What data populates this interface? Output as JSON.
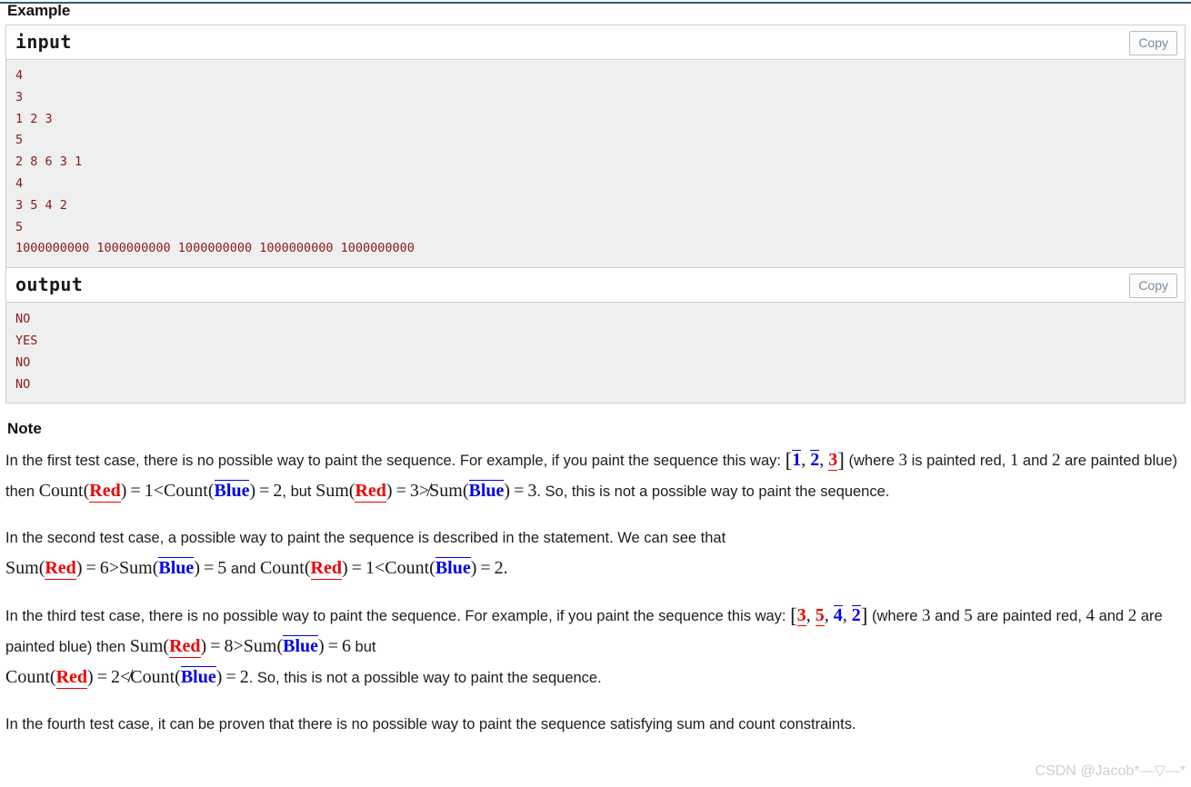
{
  "theme": {
    "top_rule_color": "#2f5b77",
    "code_text_color": "#8b1a1a",
    "code_bg_color": "#efefef",
    "red_accent": "#ee0000",
    "blue_accent": "#0000ee",
    "border_color": "#cfcfcf",
    "copy_button_text_color": "#7c8c9a",
    "watermark_color": "#c9cfd6"
  },
  "example": {
    "heading": "Example",
    "input_block": {
      "title": "input",
      "copy_label": "Copy",
      "lines": [
        "4",
        "3",
        "1 2 3",
        "5",
        "2 8 6 3 1",
        "4",
        "3 5 4 2",
        "5",
        "1000000000 1000000000 1000000000 1000000000 1000000000"
      ]
    },
    "output_block": {
      "title": "output",
      "copy_label": "Copy",
      "lines": [
        "NO",
        "YES",
        "NO",
        "NO"
      ]
    }
  },
  "note": {
    "heading": "Note",
    "p1": {
      "t1": "In the first test case, there is no possible way to paint the sequence. For example, if you paint the sequence this way: ",
      "seq": {
        "open": "[",
        "items": [
          "1",
          "2",
          "3"
        ],
        "colors": [
          "blue",
          "blue",
          "red"
        ],
        "close": "]",
        "sep": ", "
      },
      "t2": " (where ",
      "n3": "3",
      "t3": " is painted red, ",
      "n1": "1",
      "t4": " and ",
      "n2": "2",
      "t5": " are painted blue) then ",
      "count_red_lhs": {
        "fn": "Count",
        "arg": "Red",
        "eq": "=",
        "val": "1"
      },
      "rel1": "<",
      "count_blue_rhs": {
        "fn": "Count",
        "arg": "Blue",
        "eq": "=",
        "val": "2"
      },
      "t6": ", but ",
      "sum_red": {
        "fn": "Sum",
        "arg": "Red",
        "eq": "=",
        "val": "3"
      },
      "rel2": "≯",
      "sum_blue": {
        "fn": "Sum",
        "arg": "Blue",
        "eq": "=",
        "val": "3"
      },
      "t7": ". So, this is not a possible way to paint the sequence."
    },
    "p2": {
      "t1": "In the second test case, a possible way to paint the sequence is described in the statement. We can see that",
      "sum_red": {
        "fn": "Sum",
        "arg": "Red",
        "eq": "=",
        "val": "6"
      },
      "rel1": ">",
      "sum_blue": {
        "fn": "Sum",
        "arg": "Blue",
        "eq": "=",
        "val": "5"
      },
      "t2": " and ",
      "count_red": {
        "fn": "Count",
        "arg": "Red",
        "eq": "=",
        "val": "1"
      },
      "rel2": "<",
      "count_blue": {
        "fn": "Count",
        "arg": "Blue",
        "eq": "=",
        "val": "2"
      },
      "t3": "."
    },
    "p3": {
      "t1": "In the third test case, there is no possible way to paint the sequence. For example, if you paint the sequence this way: ",
      "seq": {
        "open": "[",
        "items": [
          "3",
          "5",
          "4",
          "2"
        ],
        "colors": [
          "red",
          "red",
          "blue",
          "blue"
        ],
        "close": "]",
        "sep": ", "
      },
      "t2": " (where ",
      "n3": "3",
      "t3": " and ",
      "n5": "5",
      "t4": " are painted red, ",
      "n4": "4",
      "t5": " and ",
      "n2": "2",
      "t6": " are painted blue) then ",
      "sum_red": {
        "fn": "Sum",
        "arg": "Red",
        "eq": "=",
        "val": "8"
      },
      "rel1": ">",
      "sum_blue": {
        "fn": "Sum",
        "arg": "Blue",
        "eq": "=",
        "val": "6"
      },
      "t7": " but ",
      "count_red": {
        "fn": "Count",
        "arg": "Red",
        "eq": "=",
        "val": "2"
      },
      "rel2": "≮",
      "count_blue": {
        "fn": "Count",
        "arg": "Blue",
        "eq": "=",
        "val": "2"
      },
      "t8": ". So, this is not a possible way to paint the sequence."
    },
    "p4": {
      "t1": "In the fourth test case, it can be proven that there is no possible way to paint the sequence satisfying sum and count constraints."
    }
  },
  "watermark": {
    "text": "CSDN @Jacob*—▽—*"
  }
}
